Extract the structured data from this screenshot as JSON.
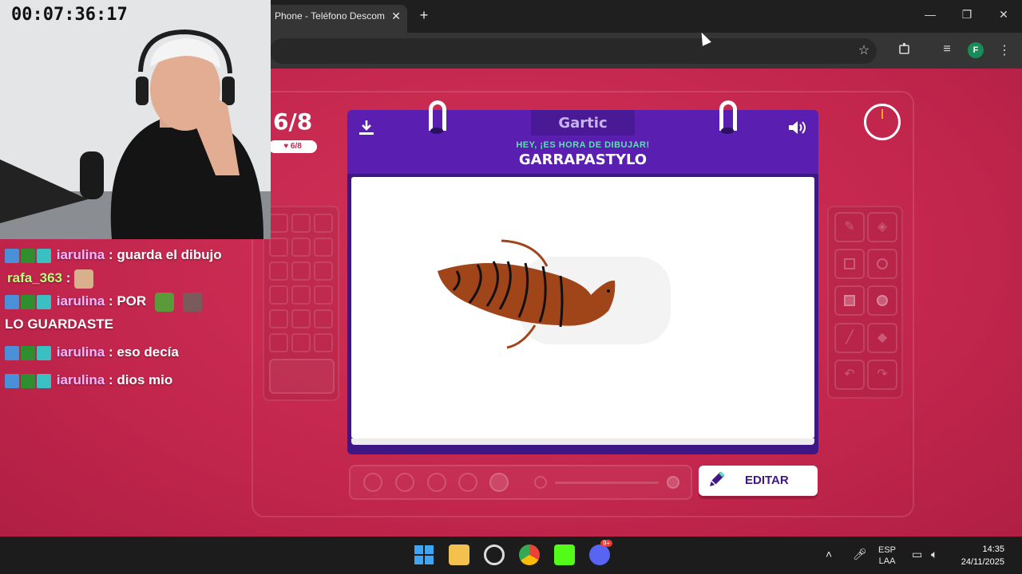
{
  "browser": {
    "tab_title": "Phone - Teléfono Descom",
    "close_glyph": "✕",
    "new_tab_glyph": "+",
    "profile_initial": "F",
    "window_controls": [
      "—",
      "❐",
      "✕"
    ]
  },
  "game": {
    "round_label": "6/8",
    "round_pill": "6/8",
    "logo": "Gartic",
    "hey_text": "HEY, ¡ES HORA DE DIBUJAR!",
    "word": "GARRAPASTYLO",
    "edit_label": "EDITAR"
  },
  "stream": {
    "timecode": "00:07:36:17"
  },
  "chat": {
    "messages": [
      {
        "user": "iarulina",
        "text": "guarda el dibujo"
      },
      {
        "user": "rafa_363",
        "text": ""
      },
      {
        "user": "iarulina",
        "text": "POR",
        "text2": "LO GUARDASTE"
      },
      {
        "user": "iarulina",
        "text": "eso decía"
      },
      {
        "user": "iarulina",
        "text": "dios mio"
      }
    ],
    "separator": ":"
  },
  "taskbar": {
    "lang_line1": "ESP",
    "lang_line2": "LAA",
    "time": "14:35",
    "date": "24/11/2025",
    "discord_badge": "9+"
  },
  "colors": {
    "accent_bg": "#c62a4f",
    "card_purple": "#5a1fb0",
    "hey_green": "#5de0b5",
    "drawing_brown": "#a0441a"
  },
  "icons": [
    "download-icon",
    "volume-icon",
    "pencil-icon",
    "timer-icon",
    "star-icon",
    "extensions-icon",
    "menu-icon"
  ]
}
